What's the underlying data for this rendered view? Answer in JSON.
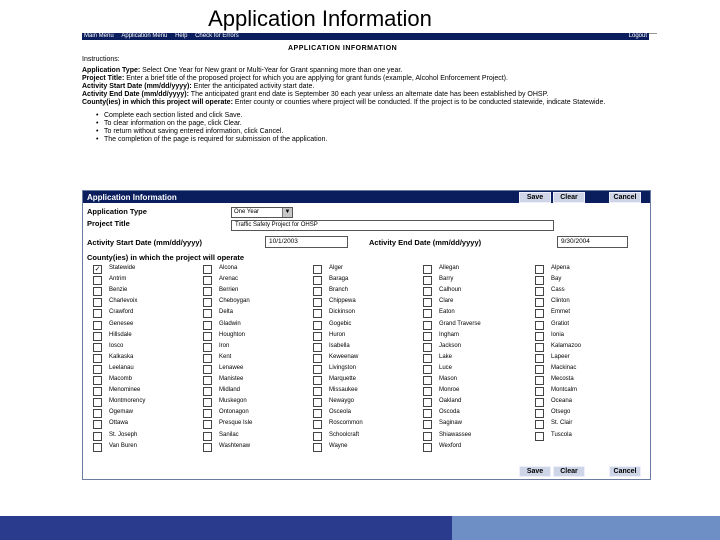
{
  "slide": {
    "title": "Application Information"
  },
  "nav": {
    "items": [
      "Main Menu",
      "Application Menu",
      "Help",
      "Check for Errors"
    ],
    "logout": "Logout"
  },
  "page_heading": "APPLICATION INFORMATION",
  "instructions": {
    "header": "Instructions:",
    "paragraphs": [
      {
        "label": "Application Type:",
        "text": "Select One Year for New grant or Multi-Year for Grant spanning more than one year."
      },
      {
        "label": "Project Title:",
        "text": "Enter a brief title of the proposed project for which you are applying for grant funds (example, Alcohol Enforcement Project)."
      },
      {
        "label": "Activity Start Date (mm/dd/yyyy):",
        "text": "Enter the anticipated activity start date."
      },
      {
        "label": "Activity End Date (mm/dd/yyyy):",
        "text": "The anticipated grant end date is September 30 each year unless an alternate date has been established by OHSP."
      },
      {
        "label": "County(ies) in which this project will operate:",
        "text": "Enter county or counties where project will be conducted. If the project is to be conducted statewide, indicate Statewide."
      }
    ],
    "bullets": [
      "Complete each section listed and click Save.",
      "To clear information on the page, click Clear.",
      "To return without saving entered information, click Cancel.",
      "The completion of the page is required for submission of the application."
    ]
  },
  "form": {
    "title": "Application Information",
    "buttons": {
      "save": "Save",
      "clear": "Clear",
      "cancel": "Cancel"
    },
    "application_type_label": "Application Type",
    "application_type_value": "One Year",
    "project_title_label": "Project Title",
    "project_title_value": "Traffic Safety Project for OHSP",
    "start_label": "Activity Start Date (mm/dd/yyyy)",
    "start_value": "10/1/2003",
    "end_label": "Activity End Date (mm/dd/yyyy)",
    "end_value": "9/30/2004",
    "counties_label": "County(ies) in which the project will operate",
    "counties": [
      [
        "Statewide",
        "Alcona",
        "Alger",
        "Allegan",
        "Alpena"
      ],
      [
        "Antrim",
        "Arenac",
        "Baraga",
        "Barry",
        "Bay"
      ],
      [
        "Benzie",
        "Berrien",
        "Branch",
        "Calhoun",
        "Cass"
      ],
      [
        "Charlevoix",
        "Cheboygan",
        "Chippewa",
        "Clare",
        "Clinton"
      ],
      [
        "Crawford",
        "Delta",
        "Dickinson",
        "Eaton",
        "Emmet"
      ],
      [
        "Genesee",
        "Gladwin",
        "Gogebic",
        "Grand Traverse",
        "Gratiot"
      ],
      [
        "Hillsdale",
        "Houghton",
        "Huron",
        "Ingham",
        "Ionia"
      ],
      [
        "Iosco",
        "Iron",
        "Isabella",
        "Jackson",
        "Kalamazoo"
      ],
      [
        "Kalkaska",
        "Kent",
        "Keweenaw",
        "Lake",
        "Lapeer"
      ],
      [
        "Leelanau",
        "Lenawee",
        "Livingston",
        "Luce",
        "Mackinac"
      ],
      [
        "Macomb",
        "Manistee",
        "Marquette",
        "Mason",
        "Mecosta"
      ],
      [
        "Menominee",
        "Midland",
        "Missaukee",
        "Monroe",
        "Montcalm"
      ],
      [
        "Montmorency",
        "Muskegon",
        "Newaygo",
        "Oakland",
        "Oceana"
      ],
      [
        "Ogemaw",
        "Ontonagon",
        "Osceola",
        "Oscoda",
        "Otsego"
      ],
      [
        "Ottawa",
        "Presque Isle",
        "Roscommon",
        "Saginaw",
        "St. Clair"
      ],
      [
        "St. Joseph",
        "Sanilac",
        "Schoolcraft",
        "Shiawassee",
        "Tuscola"
      ],
      [
        "Van Buren",
        "Washtenaw",
        "Wayne",
        "Wexford",
        ""
      ]
    ],
    "checked": [
      "Statewide"
    ]
  },
  "colors": {
    "navy": "#0a1e5e",
    "footer_left": "#2a3a8c",
    "footer_right": "#6d8fc6"
  }
}
